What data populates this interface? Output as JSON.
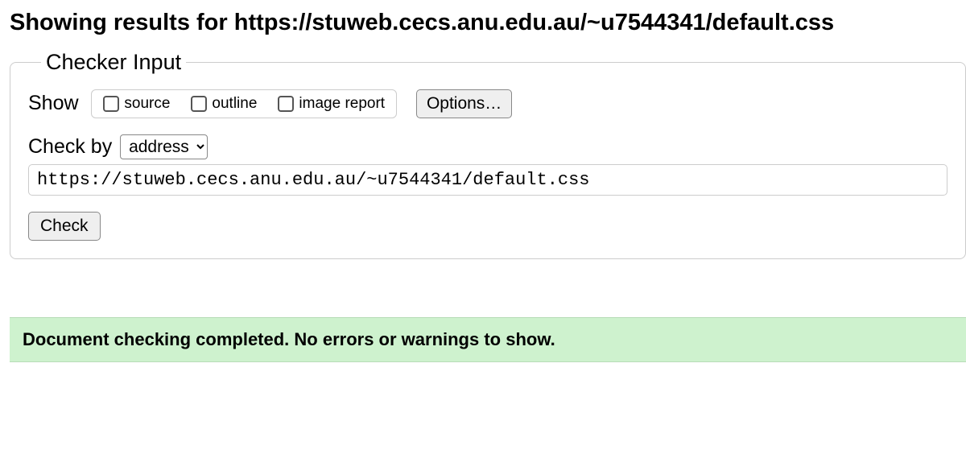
{
  "heading_prefix": "Showing results for ",
  "heading_url": "https://stuweb.cecs.anu.edu.au/~u7544341/default.css",
  "checker_input": {
    "legend": "Checker Input",
    "show_label": "Show",
    "checkboxes": {
      "source": "source",
      "outline": "outline",
      "image_report": "image report"
    },
    "options_button": "Options…",
    "checkby_label": "Check by",
    "checkby_selected": "address",
    "url_value": "https://stuweb.cecs.anu.edu.au/~u7544341/default.css",
    "check_button": "Check"
  },
  "success_message": "Document checking completed. No errors or warnings to show."
}
